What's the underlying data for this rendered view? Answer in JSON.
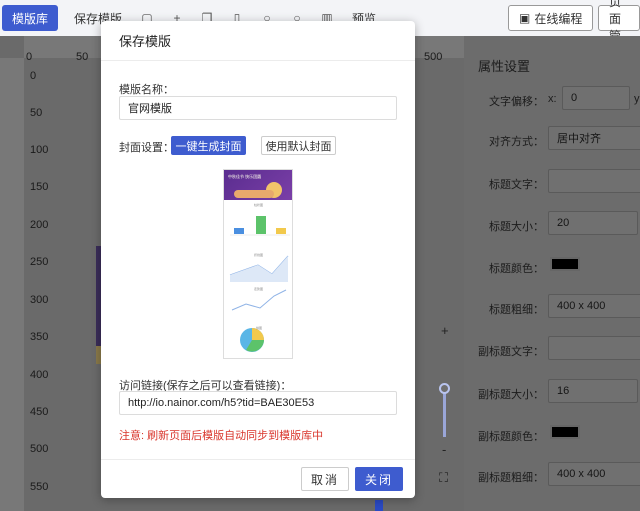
{
  "toolbar": {
    "template_library": "模版库",
    "save_template": "保存模版",
    "preview": "预览",
    "online_programming": "在线编程",
    "page_manage": "页面管"
  },
  "ruler": {
    "top_labels": [
      "0",
      "50",
      "500"
    ],
    "left_labels": [
      "0",
      "50",
      "100",
      "150",
      "200",
      "250",
      "300",
      "350",
      "400",
      "450",
      "500",
      "550"
    ]
  },
  "zoom": {
    "plus": "+",
    "minus": "-",
    "fullscreen": "⛶"
  },
  "panel": {
    "title": "属性设置",
    "text_offset_label": "文字偏移：",
    "x_label": "x:",
    "x_value": "0",
    "y_label": "y",
    "align_label": "对齐方式：",
    "align_value": "居中对齐",
    "title_text_label": "标题文字：",
    "title_text_value": "",
    "title_size_label": "标题大小：",
    "title_size_value": "20",
    "title_color_label": "标题颜色：",
    "title_weight_label": "标题粗细：",
    "title_weight_value": "400 x 400",
    "subtitle_text_label": "副标题文字：",
    "subtitle_text_value": "",
    "subtitle_size_label": "副标题大小：",
    "subtitle_size_value": "16",
    "subtitle_color_label": "副标题颜色：",
    "subtitle_weight_label": "副标题粗细：",
    "subtitle_weight_value": "400 x 400"
  },
  "modal": {
    "title": "保存模版",
    "name_label": "模版名称：",
    "name_value": "官网模版",
    "cover_label": "封面设置：",
    "generate_cover": "一键生成封面",
    "default_cover": "使用默认封面",
    "link_label": "访问链接(保存之后可以查看链接)：",
    "link_value": "http://io.nainor.com/h5?tid=BAE30E53",
    "note": "注意: 刷新页面后模版自动同步到模版库中",
    "cancel": "取消",
    "close": "关闭"
  },
  "thumbnail": {
    "title": "中秋佳节 快乐团圆",
    "sections": [
      "柱状图",
      "折线图",
      "走势图",
      "饼图"
    ]
  },
  "colors": {
    "primary": "#3e5ccf",
    "note_red": "#d9362c",
    "title_color": "#000000",
    "subtitle_color": "#000000"
  }
}
